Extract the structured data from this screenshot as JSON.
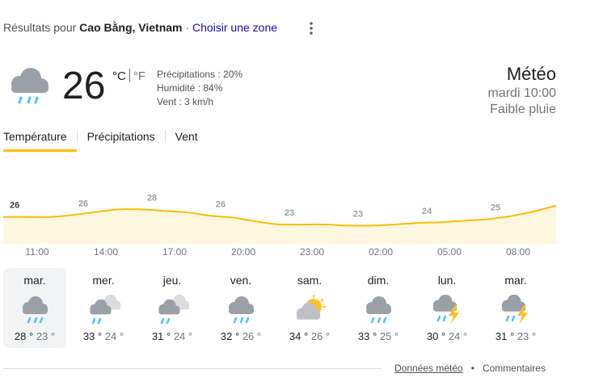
{
  "header": {
    "results_prefix": "Résultats pour ",
    "location": "Cao Bằng, Vietnam",
    "separator": " · ",
    "choose_zone": "Choisir une zone"
  },
  "current": {
    "temperature": "26",
    "unit_c": "°C",
    "unit_f": "°F",
    "precipitation": "Précipitations : 20%",
    "humidity": "Humidité : 84%",
    "wind": "Vent : 3 km/h",
    "icon": "rain-cloud-icon"
  },
  "summary": {
    "title": "Météo",
    "time": "mardi 10:00",
    "condition": "Faible pluie"
  },
  "tabs": [
    {
      "label": "Température",
      "active": true
    },
    {
      "label": "Précipitations",
      "active": false
    },
    {
      "label": "Vent",
      "active": false
    }
  ],
  "chart_data": {
    "type": "area",
    "labels": [
      "26",
      "26",
      "28",
      "26",
      "23",
      "23",
      "24",
      "25"
    ],
    "hours": [
      "11:00",
      "14:00",
      "17:00",
      "20:00",
      "23:00",
      "02:00",
      "05:00",
      "08:00"
    ],
    "x": [
      0,
      3,
      6,
      9,
      12,
      15,
      18,
      21
    ],
    "values": [
      26,
      26,
      28,
      26,
      23,
      23,
      24,
      25
    ],
    "curve_x": [
      0,
      1,
      2,
      3,
      4,
      5,
      6,
      7,
      8,
      9,
      10,
      11,
      12,
      13,
      14,
      15,
      16,
      17,
      18,
      19,
      20,
      21,
      22,
      23,
      24
    ],
    "curve_y": [
      26,
      26,
      26,
      26.5,
      27.3,
      28,
      28,
      27.6,
      27.2,
      26.3,
      25.8,
      24.8,
      24,
      24,
      24,
      23.7,
      23.7,
      24,
      24.4,
      24.6,
      25,
      25.4,
      26.2,
      27.4,
      29
    ],
    "ylim": [
      21,
      30
    ],
    "color": "#fbbc04",
    "fill": "#fef7e0"
  },
  "days": [
    {
      "name": "mar.",
      "hi": "28 °",
      "lo": "23 °",
      "icon": "rain-cloud-icon",
      "selected": true
    },
    {
      "name": "mer.",
      "hi": "33 °",
      "lo": "24 °",
      "icon": "showers-icon",
      "selected": false
    },
    {
      "name": "jeu.",
      "hi": "31 °",
      "lo": "24 °",
      "icon": "showers-icon",
      "selected": false
    },
    {
      "name": "ven.",
      "hi": "32 °",
      "lo": "26 °",
      "icon": "rain-cloud-icon",
      "selected": false
    },
    {
      "name": "sam.",
      "hi": "34 °",
      "lo": "26 °",
      "icon": "partly-cloudy-icon",
      "selected": false
    },
    {
      "name": "dim.",
      "hi": "33 °",
      "lo": "25 °",
      "icon": "rain-cloud-icon",
      "selected": false
    },
    {
      "name": "lun.",
      "hi": "30 °",
      "lo": "24 °",
      "icon": "thunderstorm-icon",
      "selected": false
    },
    {
      "name": "mar.",
      "hi": "31 °",
      "lo": "23 °",
      "icon": "thunderstorm-icon",
      "selected": false
    }
  ],
  "footer": {
    "source": "Données météo",
    "dot": "•",
    "feedback": "Commentaires"
  },
  "colors": {
    "accent": "#fbbc04",
    "link": "#1a0dab",
    "cloud": "#9aa0a6",
    "rain": "#4fc3f7",
    "sun": "#fbc02d"
  }
}
